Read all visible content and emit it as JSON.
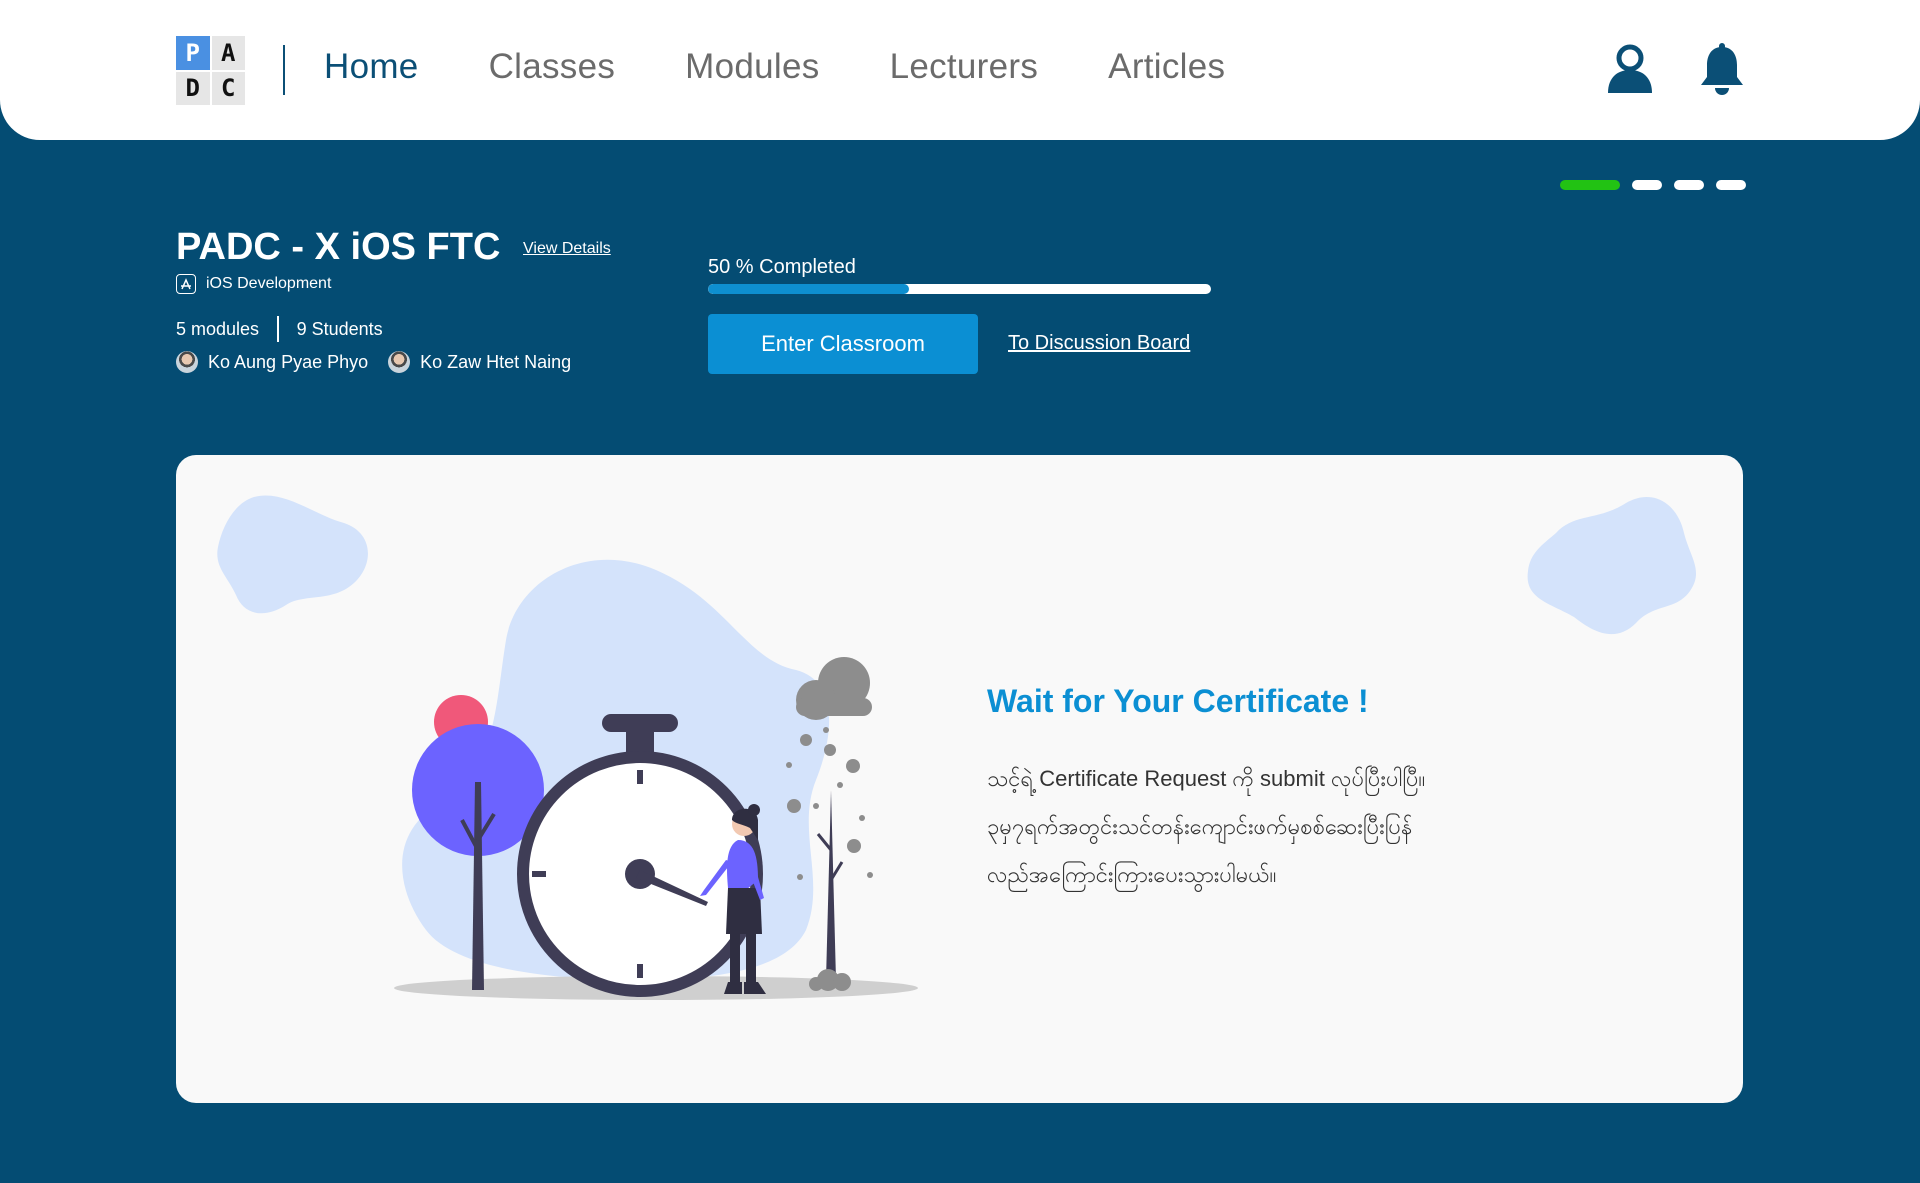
{
  "nav": {
    "logo_letters": [
      "P",
      "A",
      "D",
      "C"
    ],
    "links": [
      "Home",
      "Classes",
      "Modules",
      "Lecturers",
      "Articles"
    ],
    "active": "Home",
    "icons": [
      "user-icon",
      "bell-icon"
    ]
  },
  "slider": {
    "count": 4,
    "active_index": 0,
    "active_color": "#22c213"
  },
  "class_info": {
    "title": "PADC - X iOS FTC",
    "view_details": "View Details",
    "category": "iOS Development",
    "modules": "5 modules",
    "students": "9 Students",
    "lecturers": [
      "Ko Aung Pyae Phyo",
      "Ko Zaw Htet Naing"
    ],
    "progress_label": "50 % Completed",
    "progress_fraction": 0.4,
    "enter_button": "Enter Classroom",
    "discussion_link": "To Discussion Board"
  },
  "certificate": {
    "title": "Wait for Your Certificate !",
    "body_lines": [
      "သင့်ရဲ့ Certificate Request ကို submit လုပ်ပြီးပါပြီ။",
      "၃မှ၇ရက်အတွင်းသင်တန်းကျောင်းဖက်မှစစ်ဆေးပြီးပြန်",
      "လည်အကြောင်းကြားပေးသွားပါမယ်။"
    ]
  },
  "colors": {
    "background": "#044c73",
    "nav_background": "#ffffff",
    "accent": "#0b8fd3",
    "active_nav": "#0b4f76",
    "progress_fill": "#0e8fd0"
  }
}
